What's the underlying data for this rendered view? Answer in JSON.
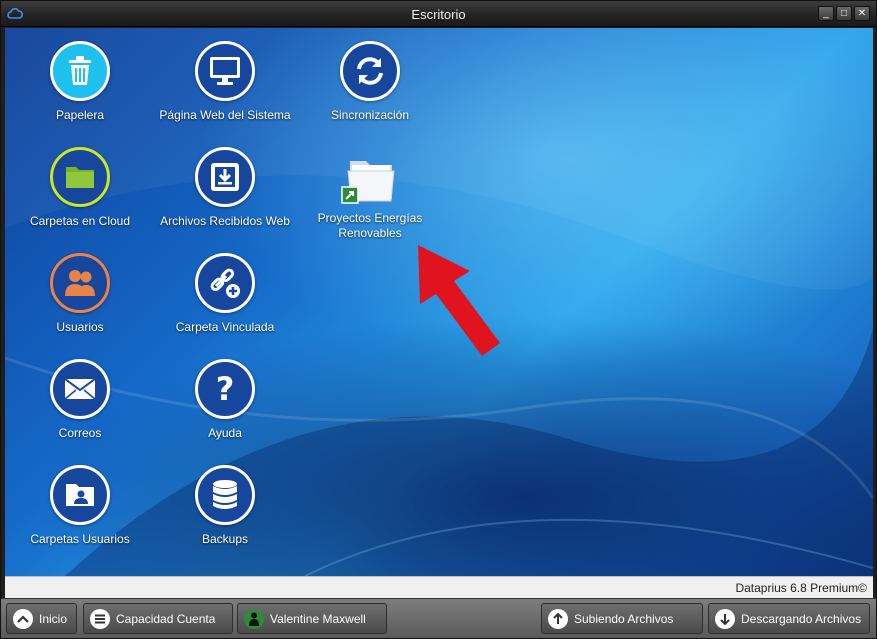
{
  "window": {
    "title": "Escritorio",
    "buttons": {
      "minimize": "_",
      "maximize": "□",
      "close": "✕"
    }
  },
  "desktop": {
    "icons": [
      {
        "label": "Papelera",
        "icon": "trash-icon",
        "color": "#1ec0ee"
      },
      {
        "label": "Página Web del Sistema",
        "icon": "monitor-icon",
        "color": "#17479d"
      },
      {
        "label": "Sincronización",
        "icon": "sync-icon",
        "color": "#17479d"
      },
      {
        "label": "Carpetas en Cloud",
        "icon": "folder-icon",
        "color": "#7ab42b"
      },
      {
        "label": "Archivos Recibidos Web",
        "icon": "inbox-download-icon",
        "color": "#17479d"
      },
      {
        "label": "Proyectos Energías Renovables",
        "icon": "folder-shortcut-icon",
        "color": "#ffffff"
      },
      {
        "label": "Usuarios",
        "icon": "users-icon",
        "color": "#e8834a"
      },
      {
        "label": "Carpeta Vinculada",
        "icon": "link-plus-icon",
        "color": "#17479d"
      },
      {
        "label": "Correos",
        "icon": "mail-icon",
        "color": "#17479d"
      },
      {
        "label": "Ayuda",
        "icon": "help-icon",
        "color": "#17479d"
      },
      {
        "label": "Carpetas Usuarios",
        "icon": "user-folder-icon",
        "color": "#17479d"
      },
      {
        "label": "Backups",
        "icon": "database-icon",
        "color": "#17479d"
      }
    ],
    "arrow_color": "#e0141e"
  },
  "status": {
    "version": "Dataprius 6.8 Premium©"
  },
  "taskbar": {
    "start": "Inicio",
    "capacity": "Capacidad Cuenta",
    "user": "Valentine Maxwell",
    "uploading": "Subiendo Archivos",
    "downloading": "Descargando Archivos"
  }
}
